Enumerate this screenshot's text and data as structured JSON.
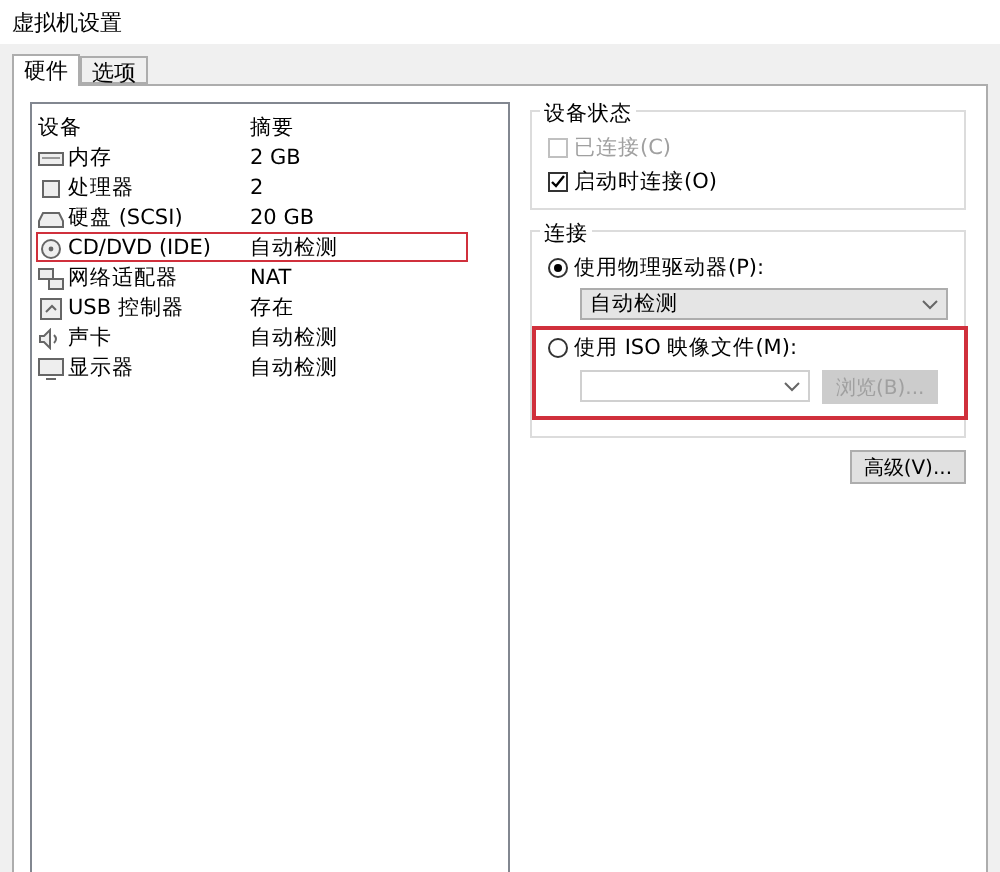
{
  "window": {
    "title": "虚拟机设置"
  },
  "tabs": [
    {
      "label": "硬件",
      "selected": true
    },
    {
      "label": "选项",
      "selected": false
    }
  ],
  "devices": {
    "columns": [
      "设备",
      "摘要"
    ],
    "rows": [
      {
        "kind": "memory",
        "name": "内存",
        "summary": "2 GB",
        "selected": false
      },
      {
        "kind": "cpu",
        "name": "处理器",
        "summary": "2",
        "selected": false
      },
      {
        "kind": "disk",
        "name": "硬盘 (SCSI)",
        "summary": "20 GB",
        "selected": false
      },
      {
        "kind": "cd",
        "name": "CD/DVD (IDE)",
        "summary": "自动检测",
        "selected": true
      },
      {
        "kind": "network",
        "name": "网络适配器",
        "summary": "NAT",
        "selected": false
      },
      {
        "kind": "usb",
        "name": "USB 控制器",
        "summary": "存在",
        "selected": false
      },
      {
        "kind": "sound",
        "name": "声卡",
        "summary": "自动检测",
        "selected": false
      },
      {
        "kind": "display",
        "name": "显示器",
        "summary": "自动检测",
        "selected": false
      }
    ]
  },
  "device_status": {
    "title": "设备状态",
    "options": [
      {
        "label": "已连接(C)",
        "checked": false,
        "disabled": true
      },
      {
        "label": "启动时连接(O)",
        "checked": true,
        "disabled": false
      }
    ]
  },
  "connection": {
    "title": "连接",
    "physical": {
      "label": "使用物理驱动器(P):",
      "selected": true,
      "value": "自动检测"
    },
    "iso": {
      "label": "使用 ISO 映像文件(M):",
      "selected": false,
      "highlighted": true,
      "browse": "浏览(B)..."
    }
  },
  "advanced_button": "高级(V)..."
}
